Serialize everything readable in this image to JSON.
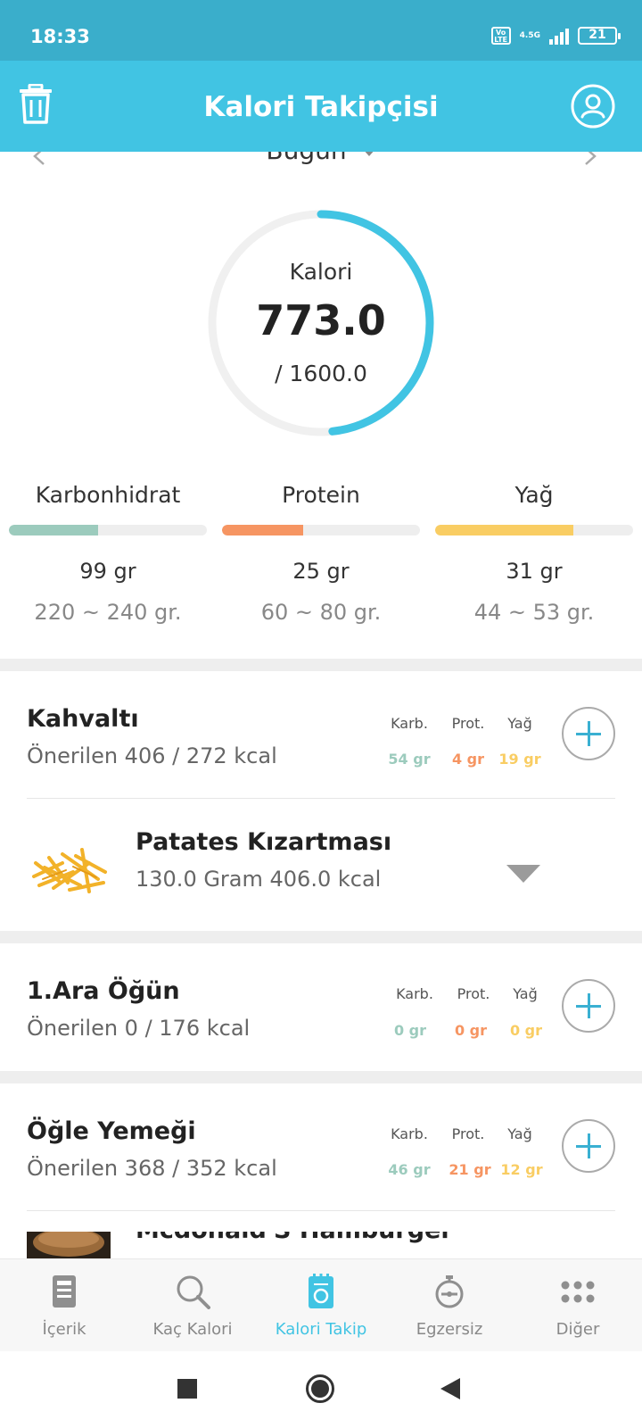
{
  "status_bar": {
    "time": "18:33",
    "network": "4.5G",
    "volte": "Vo LTE",
    "battery": "21"
  },
  "app_bar": {
    "title": "Kalori Takipçisi",
    "left_icon": "trash-icon",
    "right_icon": "user-profile-icon"
  },
  "date_nav": {
    "label": "Bugün"
  },
  "calorie_ring": {
    "label": "Kalori",
    "value": "773.0",
    "goal": "/ 1600.0",
    "progress": 0.483,
    "color": "#41c4e3"
  },
  "macros": [
    {
      "name": "Karbonhidrat",
      "value": "99 gr",
      "range": "220 ~ 240 gr.",
      "progress": 0.45,
      "color": "#9ccbbd"
    },
    {
      "name": "Protein",
      "value": "25 gr",
      "range": "60 ~ 80 gr.",
      "progress": 0.41,
      "color": "#f69562"
    },
    {
      "name": "Yağ",
      "value": "31 gr",
      "range": "44 ~ 53 gr.",
      "progress": 0.7,
      "color": "#f9cd63"
    }
  ],
  "meal_headers": {
    "carb": "Karb.",
    "prot": "Prot.",
    "fat": "Yağ"
  },
  "meals": [
    {
      "title": "Kahvaltı",
      "subtitle": "Önerilen 406 / 272 kcal",
      "carb": "54 gr",
      "prot": "4 gr",
      "fat": "19 gr",
      "items": [
        {
          "name": "Patates Kızartması",
          "detail": "130.0 Gram 406.0 kcal"
        }
      ]
    },
    {
      "title": "1.Ara Öğün",
      "subtitle": "Önerilen 0 / 176 kcal",
      "carb": "0 gr",
      "prot": "0 gr",
      "fat": "0 gr"
    },
    {
      "title": "Öğle Yemeği",
      "subtitle": "Önerilen 368 / 352 kcal",
      "carb": "46 gr",
      "prot": "21 gr",
      "fat": "12 gr",
      "items": [
        {
          "name": "Mcdonald'S Hamburger"
        }
      ]
    }
  ],
  "colors": {
    "carb": "#9ccbbd",
    "prot": "#f69562",
    "fat": "#f9cd63",
    "accent": "#41c4e3"
  },
  "bottom_nav": [
    {
      "label": "İçerik",
      "icon": "content-icon"
    },
    {
      "label": "Kaç Kalori",
      "icon": "search-icon"
    },
    {
      "label": "Kalori Takip",
      "icon": "tracker-icon",
      "active": true
    },
    {
      "label": "Egzersiz",
      "icon": "stopwatch-icon"
    },
    {
      "label": "Diğer",
      "icon": "more-grid-icon"
    }
  ]
}
